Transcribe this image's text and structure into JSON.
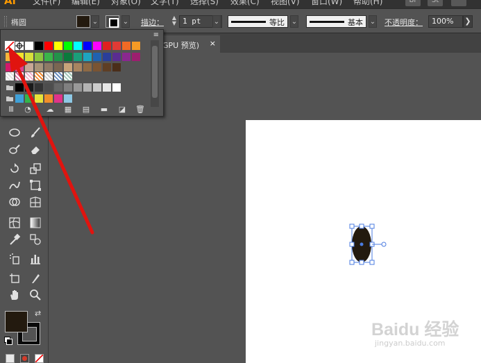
{
  "app": {
    "logo": "Ai"
  },
  "menu": {
    "items": [
      "文件(F)",
      "编辑(E)",
      "对象(O)",
      "文字(T)",
      "选择(S)",
      "效果(C)",
      "视图(V)",
      "窗口(W)",
      "帮助(H)"
    ],
    "ext": [
      "Br",
      "St"
    ]
  },
  "control_bar": {
    "selection_label": "椭圆",
    "stroke_label": "描边：",
    "stroke_weight": "1 pt",
    "stroke_profile": "等比",
    "brush_profile": "基本",
    "opacity_label": "不透明度：",
    "opacity_value": "100%",
    "arrow": "❯",
    "dropdown_arrow": "⌄"
  },
  "document_tab": {
    "title": "GPU 预览)",
    "close": "×"
  },
  "swatch_panel": {
    "menu": "≡",
    "rows": [
      [
        "none",
        "reg",
        "#ffffff",
        "#000000",
        "#ff0000",
        "#ffff00",
        "#00ff00",
        "#00ffff",
        "#0000ff",
        "#ff00ff",
        "#e02020",
        "#e03a35",
        "#f06a25",
        "#f59a25"
      ],
      [
        "#f5b63a",
        "#f2e42c",
        "#d8e03b",
        "#8cc63f",
        "#3ab54a",
        "#22934a",
        "#0a7a3c",
        "#1a9e7a",
        "#1ea5c0",
        "#2062b0",
        "#2a3e9a",
        "#5a2d91",
        "#8a288f",
        "#9c1f6f"
      ],
      [
        "#d5176a",
        "#e0408c",
        "#c8a896",
        "#a89478",
        "#8e7a66",
        "#7a6652",
        "#c7a37a",
        "#a88460",
        "#8e6a45",
        "#7a5433",
        "#5e3e24",
        "#4a2e1a"
      ],
      [
        "pattern1",
        "pattern2",
        "pattern3",
        "pattern4",
        "pattern5",
        "pattern6",
        "pattern7"
      ],
      [
        "folder",
        "#000000",
        "#1a1a1a",
        "#333333",
        "#4d4d4d",
        "#666666",
        "#808080",
        "#999999",
        "#b3b3b3",
        "#cccccc",
        "#e6e6e6",
        "#ffffff"
      ],
      [
        "folder",
        "#3fa0d8",
        "#34b44a",
        "#e8e23a",
        "#f18f2a",
        "#e0338a",
        "#8ec9e6"
      ]
    ],
    "footer_icons": [
      "library-icon",
      "swatch-kinds-icon",
      "cloud-icon",
      "color-group-icon",
      "swatch-options-icon",
      "new-group-icon",
      "new-swatch-icon",
      "delete-icon"
    ]
  },
  "toolbox": {
    "fill_color": "#231a0f",
    "stroke_color": "#0a0a0a",
    "tools": [
      "ellipse",
      "paintbrush",
      "blob-brush",
      "eraser",
      "rotate",
      "scale",
      "warp",
      "free-transform",
      "shape-builder",
      "perspective-grid",
      "mesh",
      "gradient",
      "eyedropper",
      "blend",
      "symbol-sprayer",
      "column-graph",
      "artboard",
      "slice",
      "hand",
      "zoom"
    ]
  },
  "canvas": {
    "artboard_color": "#ffffff",
    "ellipse_fill": "#231a0f",
    "selection_color": "#4a7be0"
  },
  "annotation": {
    "arrow_color": "#e0140f"
  },
  "watermark": {
    "brand": "Baidu 经验",
    "url": "jingyan.baidu.com"
  }
}
